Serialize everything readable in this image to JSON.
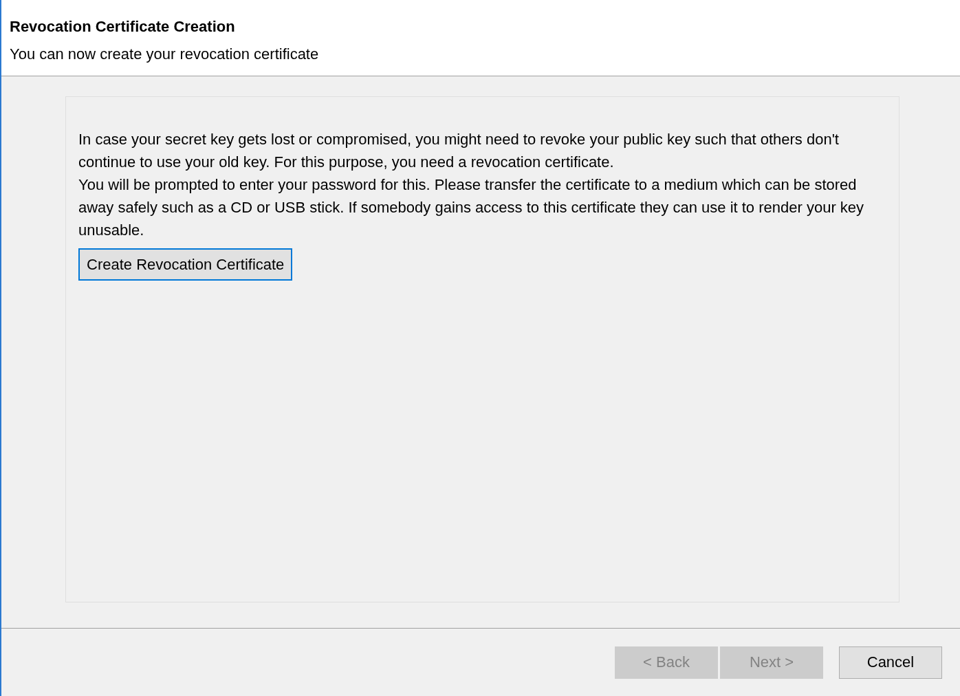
{
  "header": {
    "title": "Revocation Certificate Creation",
    "subtitle": "You can now create your revocation certificate"
  },
  "panel": {
    "paragraphs": [
      "In case your secret key gets lost or compromised, you might need to revoke your public key such that others don't continue to use your old key. For this purpose, you need a revocation certificate.",
      "You will be prompted to enter your password for this. Please transfer the certificate to a medium which can be stored away safely such as a CD or USB stick. If somebody gains access to this certificate they can use it to render your key unusable."
    ],
    "button": {
      "label": "Create Revocation Certificate",
      "focused": true
    }
  },
  "buttons": [
    {
      "label": "< Back",
      "disabled": true
    },
    {
      "label": "Next >",
      "disabled": true
    },
    {
      "label": "Cancel",
      "disabled": false
    }
  ]
}
